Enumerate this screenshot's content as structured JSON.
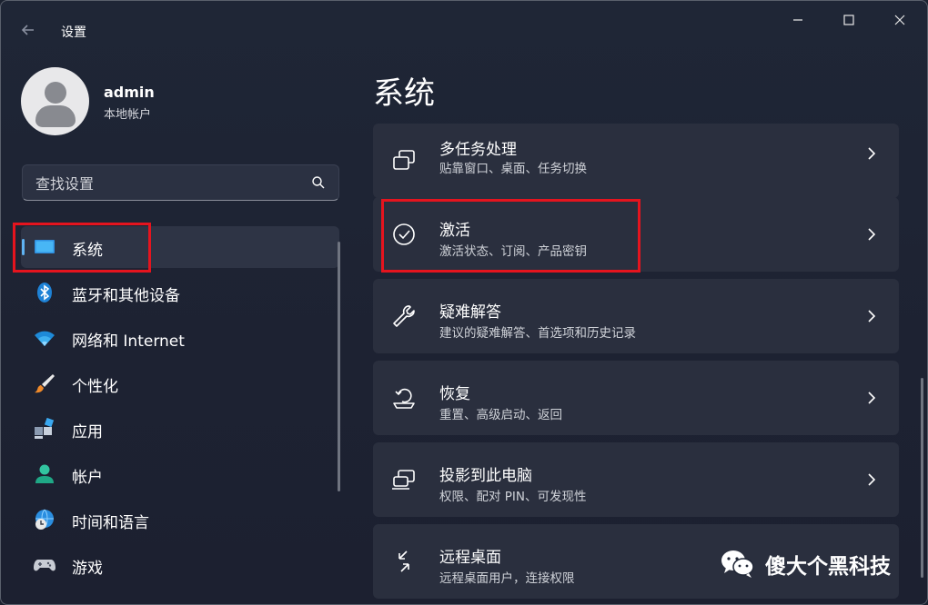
{
  "window": {
    "title": "设置",
    "back_icon": "back-arrow-icon",
    "controls": [
      "minimize-icon",
      "maximize-icon",
      "close-icon"
    ]
  },
  "account": {
    "name": "admin",
    "type": "本地帐户"
  },
  "search": {
    "placeholder": "查找设置"
  },
  "sidebar": {
    "items": [
      {
        "label": "系统",
        "icon": "system-display-icon",
        "active": true
      },
      {
        "label": "蓝牙和其他设备",
        "icon": "bluetooth-icon"
      },
      {
        "label": "网络和 Internet",
        "icon": "wifi-icon"
      },
      {
        "label": "个性化",
        "icon": "paintbrush-icon"
      },
      {
        "label": "应用",
        "icon": "apps-icon"
      },
      {
        "label": "帐户",
        "icon": "person-icon"
      },
      {
        "label": "时间和语言",
        "icon": "globe-clock-icon"
      },
      {
        "label": "游戏",
        "icon": "gamepad-icon"
      }
    ]
  },
  "main": {
    "title": "系统",
    "cards": [
      {
        "title": "多任务处理",
        "subtitle": "贴靠窗口、桌面、任务切换",
        "icon": "multitasking-icon"
      },
      {
        "title": "激活",
        "subtitle": "激活状态、订阅、产品密钥",
        "icon": "check-circle-icon"
      },
      {
        "title": "疑难解答",
        "subtitle": "建议的疑难解答、首选项和历史记录",
        "icon": "wrench-icon"
      },
      {
        "title": "恢复",
        "subtitle": "重置、高级启动、返回",
        "icon": "recovery-icon"
      },
      {
        "title": "投影到此电脑",
        "subtitle": "权限、配对 PIN、可发现性",
        "icon": "projection-icon"
      },
      {
        "title": "远程桌面",
        "subtitle": "远程桌面用户，连接权限",
        "icon": "remote-desktop-icon"
      }
    ]
  },
  "watermark": {
    "text": "傻大个黑科技"
  },
  "colors": {
    "accent": "#5fb2f2",
    "highlight": "#e5141e",
    "card_bg": "#2a2f3e",
    "window_bg": "#1f2636"
  }
}
